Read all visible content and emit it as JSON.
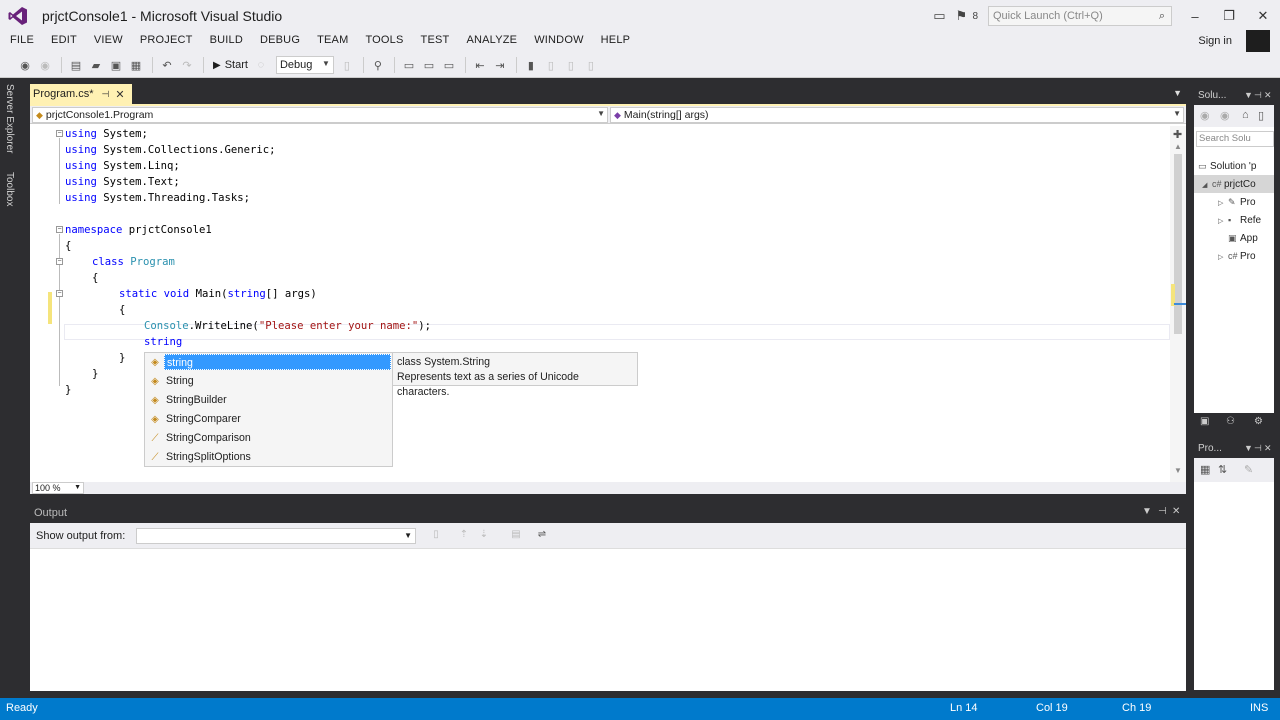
{
  "window": {
    "title": "prjctConsole1 - Microsoft Visual Studio",
    "notification_count": "8",
    "quick_launch_placeholder": "Quick Launch (Ctrl+Q)"
  },
  "menu": {
    "items": [
      "FILE",
      "EDIT",
      "VIEW",
      "PROJECT",
      "BUILD",
      "DEBUG",
      "TEAM",
      "TOOLS",
      "TEST",
      "ANALYZE",
      "WINDOW",
      "HELP"
    ],
    "sign_in": "Sign in"
  },
  "toolbar": {
    "start_label": "Start",
    "configuration": "Debug"
  },
  "left_tabs": [
    "Server Explorer",
    "Toolbox"
  ],
  "editor": {
    "tab_label": "Program.cs*",
    "nav_left": "prjctConsole1.Program",
    "nav_right": "Main(string[] args)",
    "zoom": "100 %",
    "code": {
      "l1_kw": "using",
      "l1_rest": " System;",
      "l2_kw": "using",
      "l2_rest": " System.Collections.Generic;",
      "l3_kw": "using",
      "l3_rest": " System.Linq;",
      "l4_kw": "using",
      "l4_rest": " System.Text;",
      "l5_kw": "using",
      "l5_rest": " System.Threading.Tasks;",
      "l7_kw": "namespace",
      "l7_rest": " prjctConsole1",
      "l8": "{",
      "l9_kw": "class",
      "l9_type": "Program",
      "l10": "{",
      "l11_kw1": "static",
      "l11_kw2": "void",
      "l11_name": " Main(",
      "l11_kw3": "string",
      "l11_rest": "[] args)",
      "l12": "{",
      "l13_type": "Console",
      "l13_mid": ".WriteLine(",
      "l13_str": "\"Please enter your name:\"",
      "l13_end": ");",
      "l14": "string",
      "l15": "}",
      "l16": "}",
      "l17": "}"
    },
    "completion": {
      "items": [
        "string",
        "String",
        "StringBuilder",
        "StringComparer",
        "StringComparison",
        "StringSplitOptions"
      ],
      "tooltip_line1": "class System.String",
      "tooltip_line2": "Represents text as a series of Unicode characters."
    }
  },
  "output": {
    "title": "Output",
    "show_from_label": "Show output from:",
    "show_from_value": ""
  },
  "solution_explorer": {
    "title": "Solu...",
    "search_placeholder": "Search Solu",
    "tree": [
      "Solution 'p",
      "prjctCo",
      "Pro",
      "Refe",
      "App",
      "Pro"
    ]
  },
  "properties": {
    "title": "Pro..."
  },
  "status": {
    "text": "Ready",
    "line": "Ln 14",
    "col": "Col 19",
    "ch": "Ch 19",
    "mode": "INS"
  },
  "colors": {
    "status_bar": "#007acc",
    "tab_active": "#fff1b3",
    "selection": "#3399ff",
    "keyword": "#0000ff",
    "type": "#2b91af",
    "string": "#a31515"
  }
}
